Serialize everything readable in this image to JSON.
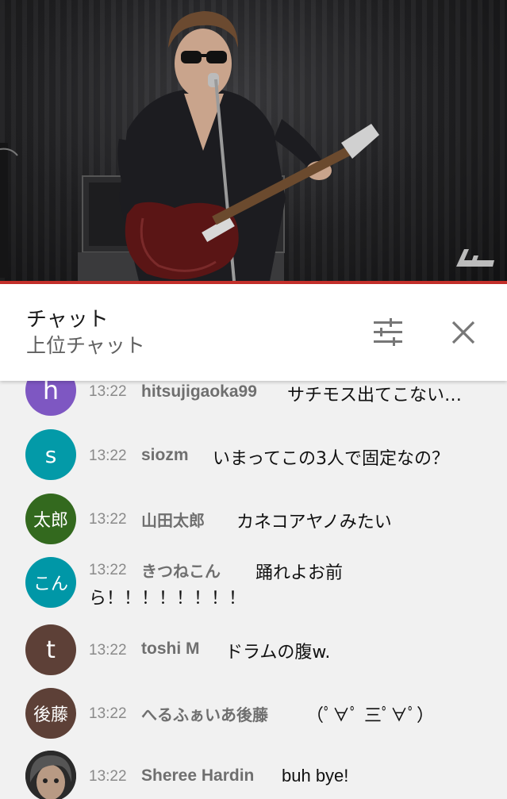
{
  "colors": {
    "progress": "#c4302b",
    "avatar_h": "#7e57c2",
    "avatar_s": "#039aa8",
    "avatar_taro": "#33691e",
    "avatar_kon": "#0097a7",
    "avatar_t": "#5d4037",
    "avatar_goto": "#5d4037"
  },
  "video": {
    "content": "live concert stream frame",
    "watermark_icon": "channel-watermark-icon"
  },
  "chat_header": {
    "title": "チャット",
    "subtitle": "上位チャット",
    "filter_icon": "tune-icon",
    "close_icon": "close-icon"
  },
  "messages": [
    {
      "avatar_text": "h",
      "time": "13:22",
      "author": "hitsujigaoka99",
      "text": "サチモス出てこない…"
    },
    {
      "avatar_text": "s",
      "time": "13:22",
      "author": "siozm",
      "text": "いまってこの3人で固定なの？"
    },
    {
      "avatar_text": "太郎",
      "time": "13:22",
      "author": "山田太郎",
      "text": "カネコアヤノみたい"
    },
    {
      "avatar_text": "こん",
      "time": "13:22",
      "author": "きつねこん",
      "text": "踊れよお前",
      "text_cont": "ら！！！！！！！！"
    },
    {
      "avatar_text": "t",
      "time": "13:22",
      "author": "toshi M",
      "text": "ドラムの腹w."
    },
    {
      "avatar_text": "後藤",
      "time": "13:22",
      "author": "へるふぁいあ後藤",
      "text": "（ﾟ∀ﾟ 三ﾟ∀ﾟ）"
    },
    {
      "avatar_text": "",
      "time": "13:22",
      "author": "Sheree Hardin",
      "text": "buh bye!"
    }
  ]
}
